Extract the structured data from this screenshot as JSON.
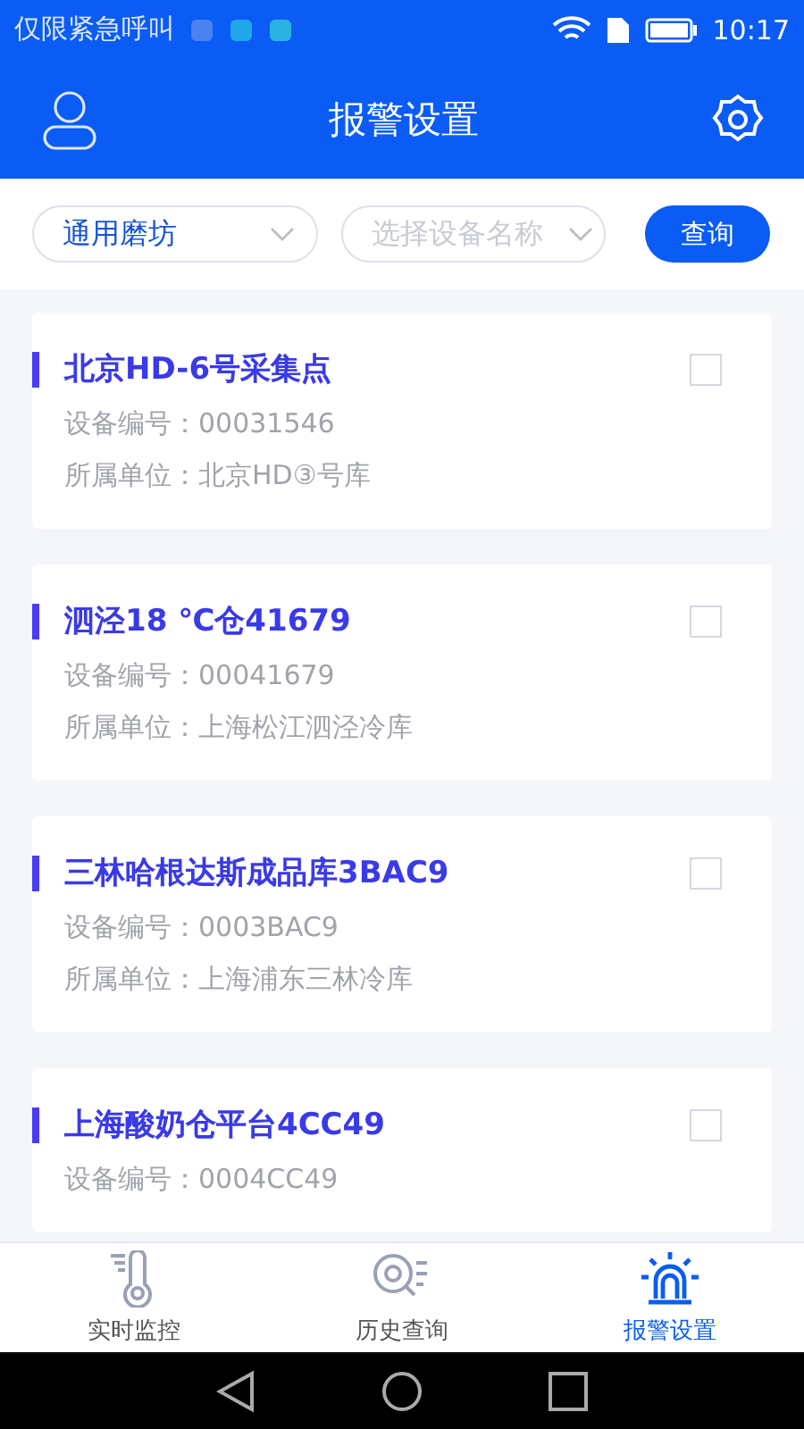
{
  "status_bar": {
    "carrier": "仅限紧急呼叫",
    "time": "10:17"
  },
  "header": {
    "title": "报警设置"
  },
  "filters": {
    "company": "通用磨坊",
    "device": {
      "placeholder": "选择设备名称"
    },
    "query_button": "查询"
  },
  "devices": [
    {
      "name": "北京HD-6号采集点",
      "checked": false,
      "fields": [
        {
          "label": "设备编号：",
          "value": "00031546"
        },
        {
          "label": "所属单位：",
          "value": "北京HD③号库"
        }
      ]
    },
    {
      "name": "泗泾18 ℃仓41679",
      "checked": false,
      "fields": [
        {
          "label": "设备编号：",
          "value": "00041679"
        },
        {
          "label": "所属单位：",
          "value": "上海松江泗泾冷库"
        }
      ]
    },
    {
      "name": "三林哈根达斯成品库3BAC9",
      "checked": false,
      "fields": [
        {
          "label": "设备编号：",
          "value": "0003BAC9"
        },
        {
          "label": "所属单位：",
          "value": "上海浦东三林冷库"
        }
      ]
    },
    {
      "name": "上海酸奶仓平台4CC49",
      "checked": false,
      "fields": [
        {
          "label": "设备编号：",
          "value": "0004CC49"
        }
      ]
    }
  ],
  "tabs": [
    {
      "label": "实时监控",
      "kind": "thermometer",
      "selected": false
    },
    {
      "label": "历史查询",
      "kind": "history",
      "selected": false
    },
    {
      "label": "报警设置",
      "kind": "alarm",
      "selected": true
    }
  ]
}
